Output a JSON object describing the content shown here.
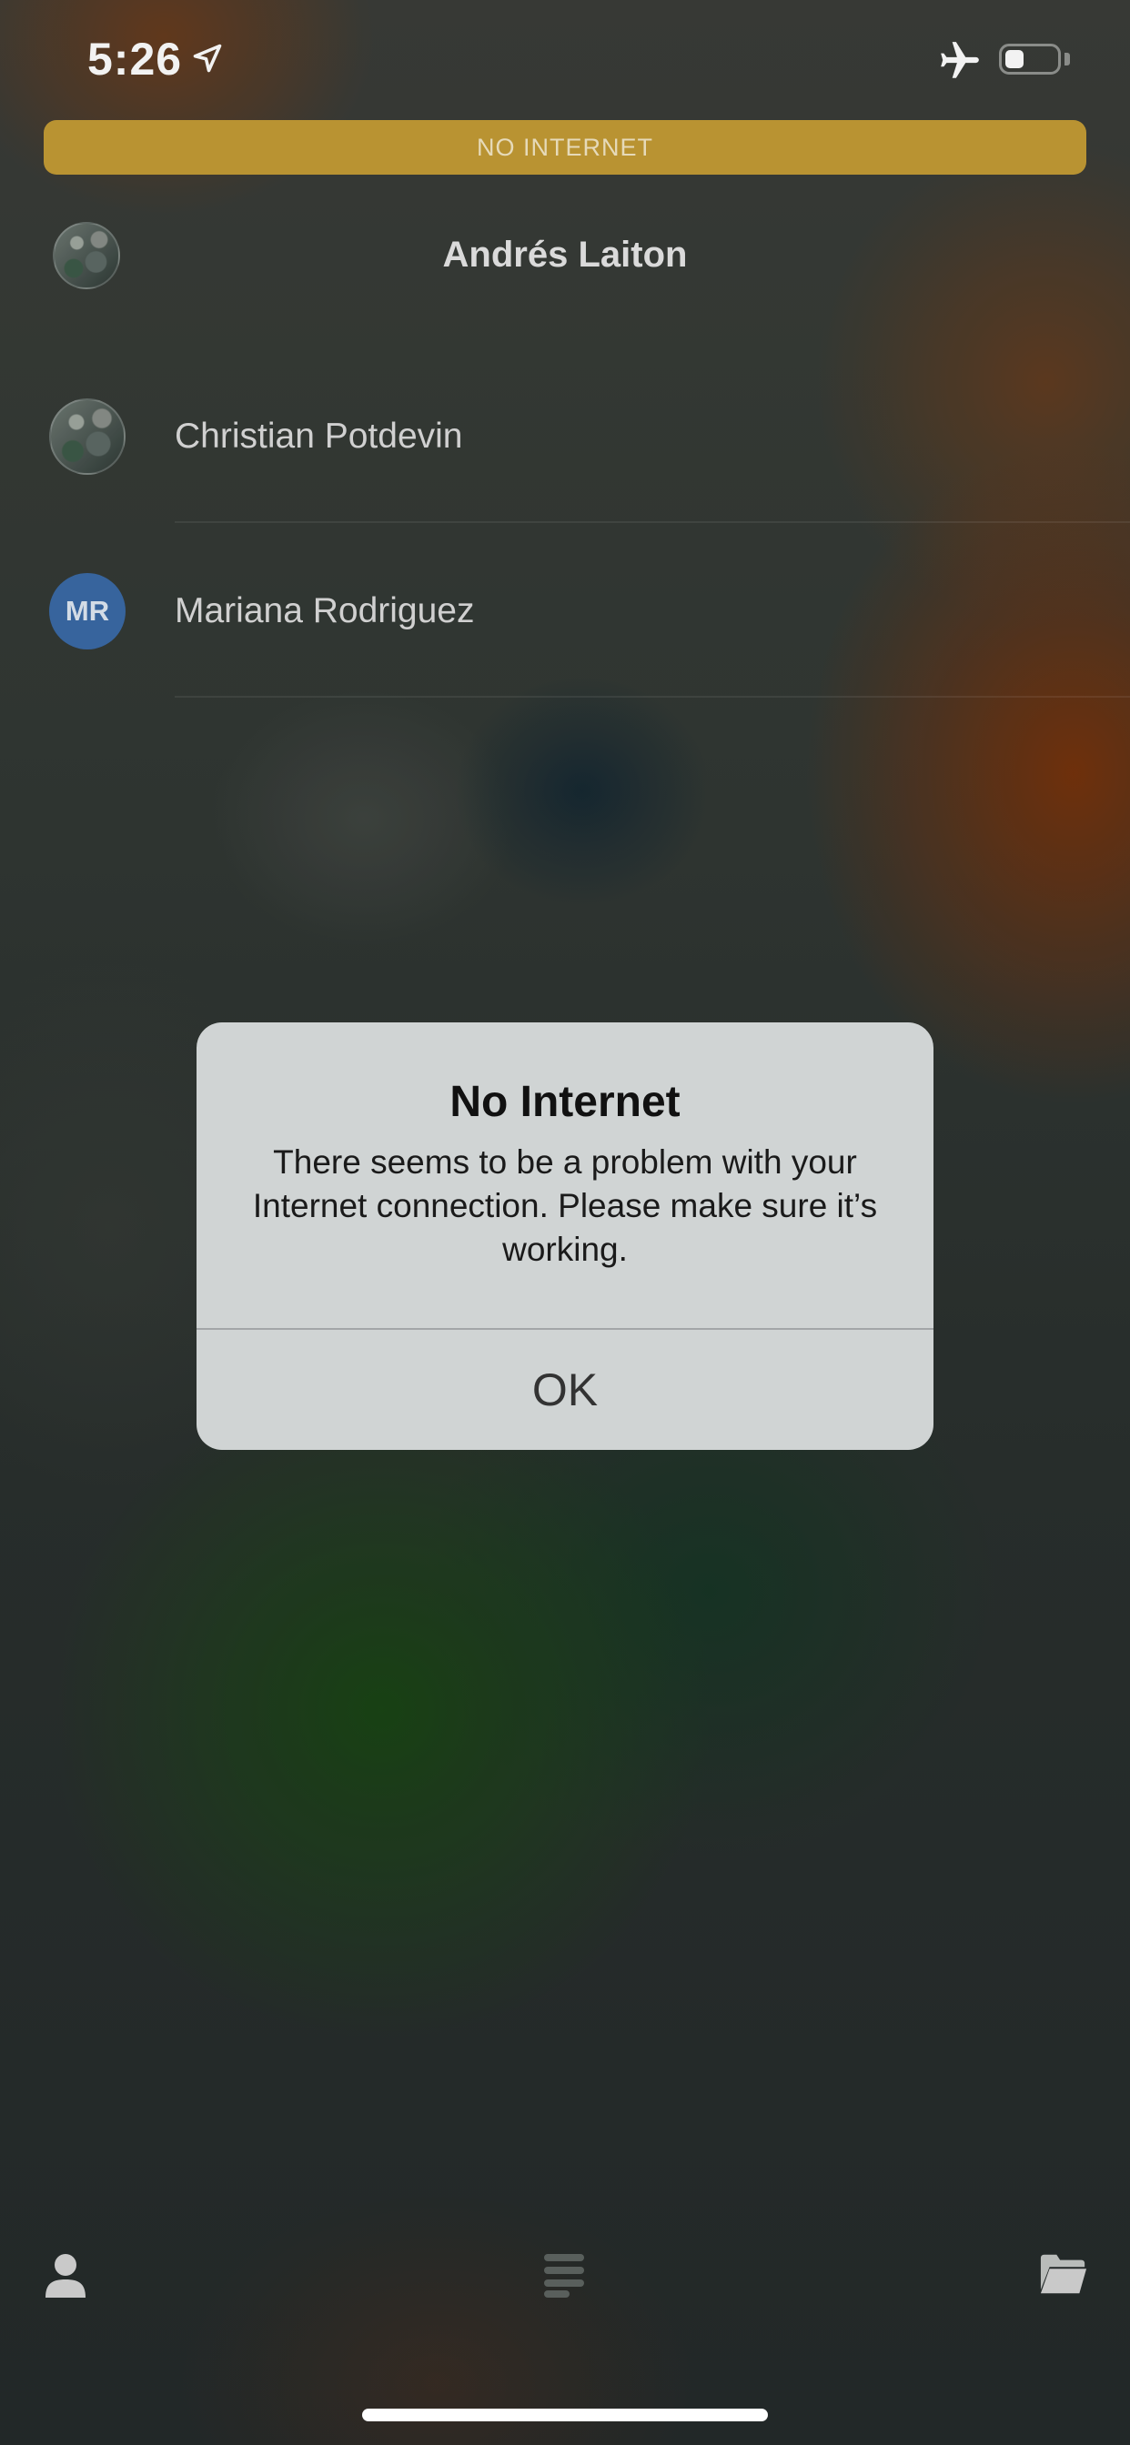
{
  "status_bar": {
    "time": "5:26",
    "icons": [
      "location-arrow-icon",
      "airplane-icon",
      "battery-icon"
    ]
  },
  "banner": {
    "text": "NO INTERNET",
    "color": "#c39b35"
  },
  "header": {
    "title": "Andrés Laiton"
  },
  "contacts": [
    {
      "name": "Christian Potdevin",
      "avatar": "photo"
    },
    {
      "name": "Mariana Rodriguez",
      "initials": "MR",
      "avatar_color": "#3a6aa6"
    }
  ],
  "alert": {
    "title": "No Internet",
    "message": "There seems to be a problem with your Internet connection. Please make sure it’s working.",
    "ok_label": "OK"
  },
  "tab_bar": {
    "items": [
      "profile-icon",
      "feed-icon",
      "folder-icon"
    ]
  }
}
